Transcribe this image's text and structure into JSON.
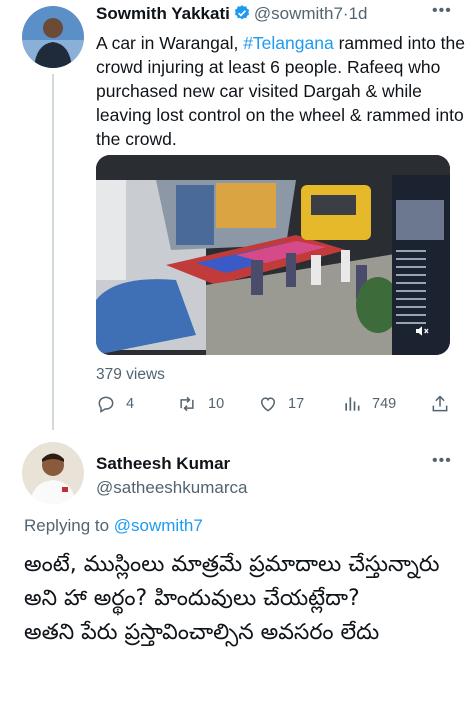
{
  "tweet": {
    "author_name": "Sowmith Yakkati",
    "author_handle": "@sowmith7",
    "separator": "·",
    "time": "1d",
    "text_before_hashtag": "A car in Warangal, ",
    "hashtag": "#Telangana",
    "text_after_hashtag": " rammed into the crowd injuring at least 6 people. Rafeeq who purchased new car visited Dargah & while leaving lost control on the wheel & rammed into the crowd.",
    "views_label": "379 views",
    "actions": {
      "replies": "4",
      "retweets": "10",
      "likes": "17",
      "views": "749"
    },
    "icons": [
      "verified-badge-icon",
      "more-icon",
      "reply-icon",
      "retweet-icon",
      "like-icon",
      "views-icon",
      "share-icon",
      "mute-icon"
    ]
  },
  "reply": {
    "author_name": "Satheesh Kumar",
    "author_handle": "@satheeshkumarca",
    "replying_prefix": "Replying to ",
    "replying_to": "@sowmith7",
    "lines": [
      "అంటే, ముస్లింలు మాత్రమే ప్రమాదాలు చేస్తున్నారు అని హా అర్థం? హిందువులు చేయట్లేదా?",
      "అతని పేరు ప్రస్తావించాల్సిన అవసరం లేదు"
    ]
  },
  "colors": {
    "accent": "#1d9bf0",
    "text": "#0f1419",
    "muted": "#536471"
  }
}
